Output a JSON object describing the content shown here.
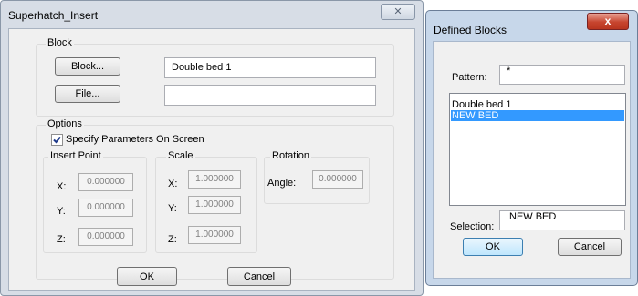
{
  "insert_dialog": {
    "title": "Superhatch_Insert",
    "close_glyph": "✕",
    "block_group": {
      "label": "Block",
      "block_button": "Block...",
      "block_value": "Double bed 1",
      "file_button": "File...",
      "file_value": ""
    },
    "options_group": {
      "label": "Options",
      "specify_checkbox_label": "Specify Parameters On Screen",
      "specify_checked": true,
      "insert_point": {
        "label": "Insert Point",
        "x_label": "X:",
        "x_value": "0.000000",
        "y_label": "Y:",
        "y_value": "0.000000",
        "z_label": "Z:",
        "z_value": "0.000000"
      },
      "scale": {
        "label": "Scale",
        "x_label": "X:",
        "x_value": "1.000000",
        "y_label": "Y:",
        "y_value": "1.000000",
        "z_label": "Z:",
        "z_value": "1.000000"
      },
      "rotation": {
        "label": "Rotation",
        "angle_label": "Angle:",
        "angle_value": "0.000000"
      }
    },
    "ok_button": "OK",
    "cancel_button": "Cancel"
  },
  "blocks_dialog": {
    "title": "Defined Blocks",
    "close_glyph": "x",
    "pattern_label": "Pattern:",
    "pattern_value": "*",
    "items": [
      "Double bed 1",
      "NEW BED"
    ],
    "selected_index": 1,
    "selection_label": "Selection:",
    "selection_value": "NEW BED",
    "ok_button": "OK",
    "cancel_button": "Cancel"
  },
  "colors": {
    "selection_highlight": "#3399ff",
    "close_button_red": "#c7452f"
  }
}
